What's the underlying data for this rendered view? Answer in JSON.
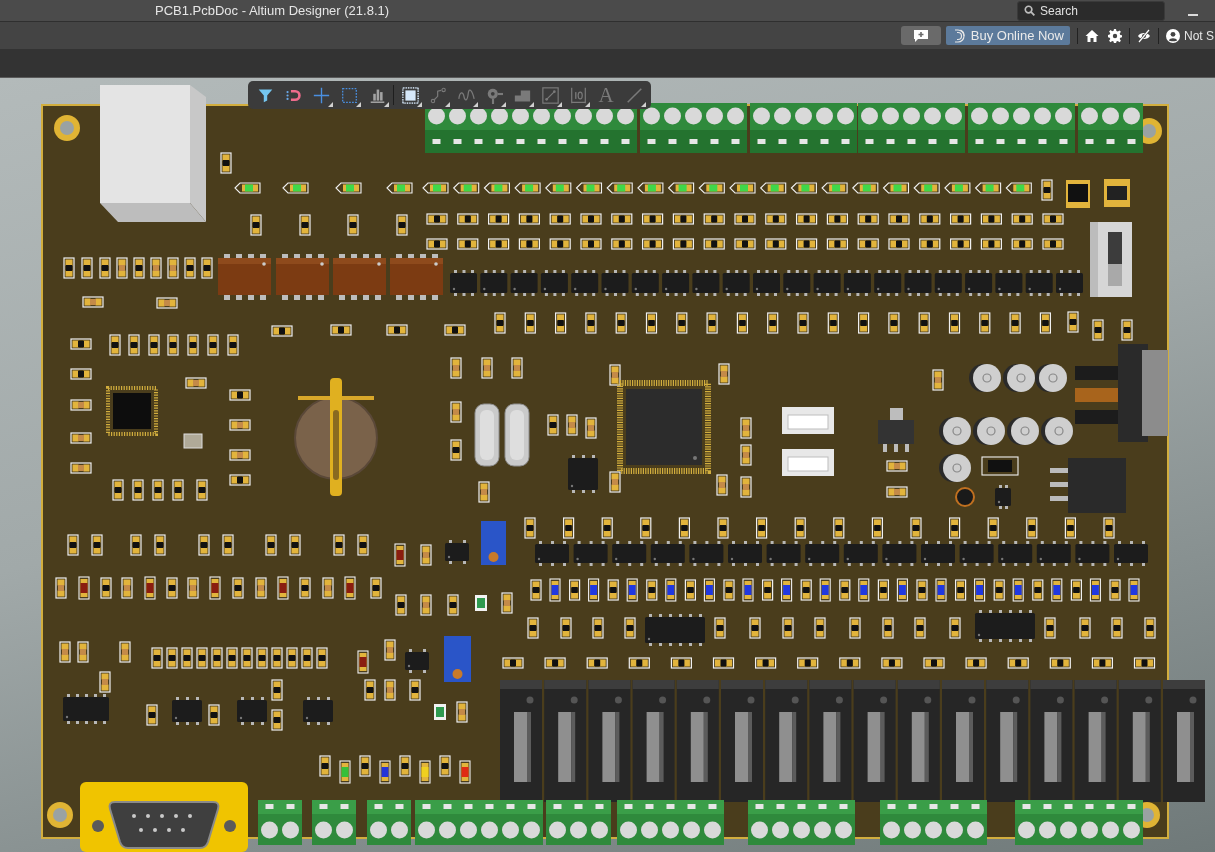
{
  "window": {
    "title": "PCB1.PcbDoc - Altium Designer (21.8.1)"
  },
  "search": {
    "placeholder": "Search"
  },
  "header": {
    "buy_button": "Buy Online Now",
    "account_label": "Not S"
  },
  "view_toolbar": {
    "groups": [
      [
        {
          "kind": "filter",
          "disabled": false,
          "menu": false
        },
        {
          "kind": "snap",
          "disabled": false,
          "menu": false
        },
        {
          "kind": "cross",
          "disabled": false,
          "menu": true
        },
        {
          "kind": "select",
          "disabled": false,
          "menu": true
        },
        {
          "kind": "align",
          "disabled": false,
          "menu": true
        }
      ],
      [
        {
          "kind": "component",
          "disabled": false,
          "menu": true
        },
        {
          "kind": "route",
          "disabled": true,
          "menu": true
        },
        {
          "kind": "tune",
          "disabled": true,
          "menu": true
        },
        {
          "kind": "via",
          "disabled": true,
          "menu": true
        },
        {
          "kind": "fill",
          "disabled": true,
          "menu": true
        },
        {
          "kind": "region",
          "disabled": true,
          "menu": true
        },
        {
          "kind": "dimension",
          "disabled": true,
          "menu": true
        },
        {
          "kind": "text",
          "glyph": "A",
          "disabled": true,
          "menu": false
        },
        {
          "kind": "line",
          "disabled": true,
          "menu": true
        }
      ]
    ]
  },
  "board": {
    "slide_switch": {
      "on": true
    }
  }
}
